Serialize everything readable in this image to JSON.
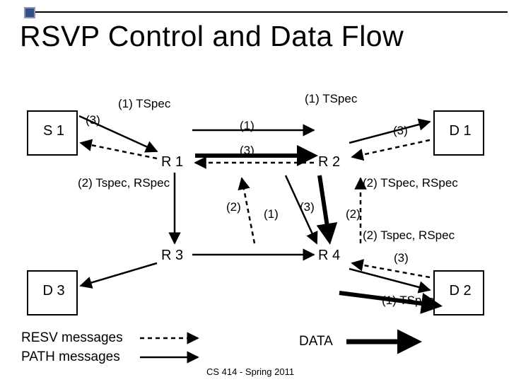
{
  "title": "RSVP Control and Data Flow",
  "nodes": {
    "s1": "S 1",
    "d1": "D 1",
    "d2": "D 2",
    "d3": "D 3",
    "r1": "R 1",
    "r2": "R 2",
    "r3": "R 3",
    "r4": "R 4"
  },
  "labels": {
    "tspec_top_left": "(1) TSpec",
    "tspec_top_right": "(1) TSpec",
    "tspec_rspec_left": "(2) Tspec, RSpec",
    "tspec_rspec_right_top": "(2) TSpec, RSpec",
    "tspec_rspec_right_mid": "(2) Tspec, RSpec",
    "tspec_near_d2": "(1) TSpec",
    "n3_s1": "(3)",
    "n1_mid": "(1)",
    "n3_mid": "(3)",
    "n3_right": "(3)",
    "n2_mid": "(2)",
    "n1_low": "(1)",
    "n3_low": "(3)",
    "n2_low": "(2)",
    "n3_r4": "(3)"
  },
  "legend": {
    "resv": "RESV messages",
    "path": "PATH messages",
    "data": "DATA"
  },
  "footer": "CS 414 - Spring 2011"
}
